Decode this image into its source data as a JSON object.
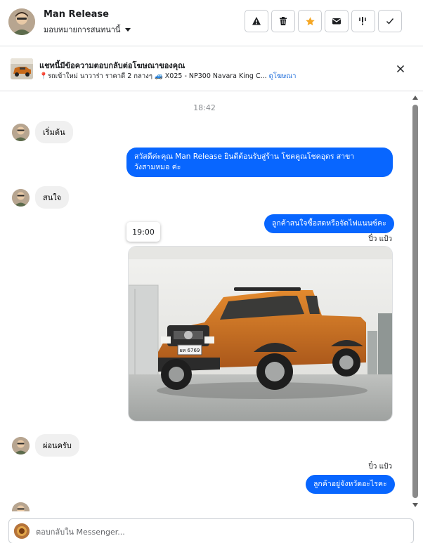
{
  "header": {
    "contact_name": "Man Release",
    "assign_label": "มอบหมายการสนทนานี้",
    "actions": [
      {
        "icon": "warning-icon",
        "name": "spam-button"
      },
      {
        "icon": "trash-icon",
        "name": "delete-button"
      },
      {
        "icon": "star-icon",
        "name": "star-button",
        "color": "#f5a623"
      },
      {
        "icon": "envelope-icon",
        "name": "mark-unread-button"
      },
      {
        "icon": "follow-up-icon",
        "name": "follow-up-button"
      },
      {
        "icon": "check-icon",
        "name": "done-button"
      }
    ]
  },
  "ad": {
    "title": "แชทนี้มีข้อความตอบกลับต่อโฆษณาของคุณ",
    "description": "📍รถเข้าใหม่ นาวาร่า ราคาดี 2 กลางๆ 🚙 X025 - NP300 Navara King C...",
    "link": "ดูโฆษณา"
  },
  "chat": {
    "timestamp": "18:42",
    "messages": [
      {
        "dir": "in",
        "text": "เริ่มต้น"
      },
      {
        "dir": "out",
        "text": "สวัสดีค่ะคุณ Man Release ยินดีต้อนรับสู่ร้าน โชคคูณโชคอุดร สาขา วังสามหมอ ค่ะ"
      },
      {
        "dir": "in",
        "text": "สนใจ"
      },
      {
        "dir": "out",
        "text": "ลูกค้าสนใจซื้อสดหรือจัดไฟแนนซ์คะ"
      },
      {
        "dir": "out",
        "text": "ลูกค้าอยู่จังหวัดอะไรคะ"
      },
      {
        "dir": "in",
        "text": "ผ่อนครับ"
      }
    ],
    "seen_label_1": "ปิ๋ว แป้ว",
    "seen_label_2": "ปิ๋ว แป้ว",
    "photo_time_tooltip": "19:00",
    "photo_plate": "ผห 6769"
  },
  "composer": {
    "placeholder": "ตอบกลับใน Messenger..."
  },
  "colors": {
    "accent": "#0866ff",
    "bubble_in": "#f0f0f0",
    "truck": "#d2761e"
  }
}
